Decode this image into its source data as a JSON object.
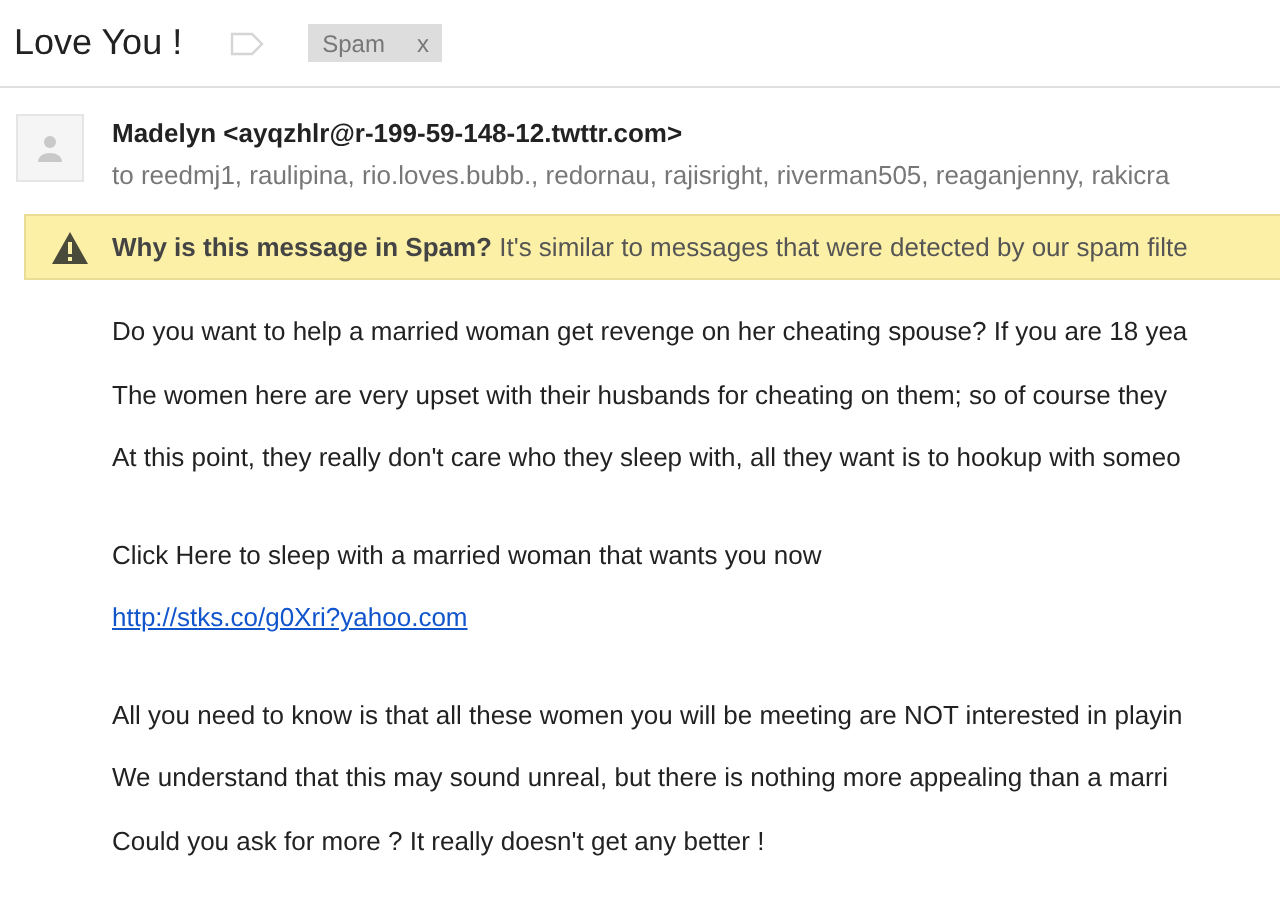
{
  "subject": {
    "title": "Love You !",
    "labels": [
      {
        "text": "Spam",
        "remove": "x"
      }
    ]
  },
  "message": {
    "sender": "Madelyn <ayqzhlr@r-199-59-148-12.twttr.com>",
    "recipients": "to reedmj1, raulipina, rio.loves.bubb., redornau, rajisright, riverman505, reaganjenny, rakicra",
    "warning": "**Why is this message in Spam?** It's similar to messages that were detected by our spam filte",
    "body": [
      {
        "kind": "text",
        "text": "Do you want to help a married woman get revenge on her cheating spouse? If you are 18 yea"
      },
      {
        "kind": "text",
        "text": "The women here are very upset with their husbands for cheating on them; so of course they"
      },
      {
        "kind": "text",
        "text": "At this point, they really don't care who they sleep with, all they want is to hookup with someo"
      },
      {
        "kind": "gap"
      },
      {
        "kind": "text",
        "text": "Click Here to sleep with a married woman that wants you now"
      },
      {
        "kind": "link",
        "text": "http://stks.co/g0Xri?yahoo.com"
      },
      {
        "kind": "gap"
      },
      {
        "kind": "text",
        "text": "All you need to know is that all these women you will be meeting are NOT interested in playin"
      },
      {
        "kind": "text",
        "text": "We understand that this may sound unreal, but there is nothing more appealing than a marri"
      },
      {
        "kind": "text",
        "text": "Could you ask for more ? It really doesn't get any better !"
      }
    ]
  }
}
